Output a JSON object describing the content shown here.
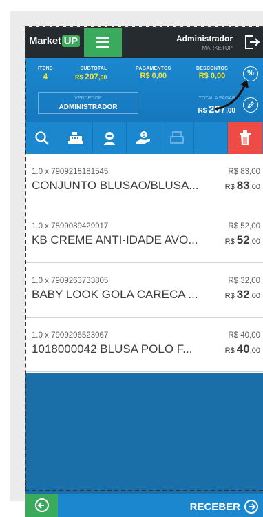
{
  "header": {
    "logo_text": "Market",
    "logo_badge": "UP",
    "user_name": "Administrador",
    "company": "MARKETUP"
  },
  "summary": {
    "items_label": "ITENS",
    "items_value": "4",
    "subtotal_label": "SUBTOTAL",
    "subtotal_currency": "R$ ",
    "subtotal_value": "207",
    "subtotal_cents": ",00",
    "payments_label": "PAGAMENTOS",
    "payments_value": "R$ 0,00",
    "discounts_label": "DESCONTOS",
    "discounts_value": "R$ 0,00",
    "seller_label": "VENDEDOR",
    "seller_value": "ADMINISTRADOR",
    "to_pay_label": "TOTAL A PAGAR",
    "to_pay_currency": "R$ ",
    "to_pay_value": "207",
    "to_pay_cents": ",00",
    "percent_symbol": "%"
  },
  "toolbar": {
    "icons": [
      "search-icon",
      "cash-register-icon",
      "customer-icon",
      "payment-hand-icon",
      "printer-icon",
      "trash-icon"
    ]
  },
  "items": [
    {
      "qty_code": "1.0 x 7909218181545",
      "unit_price": "R$ 83,00",
      "name": "CONJUNTO BLUSAO/BLUSA...",
      "total_currency": "R$ ",
      "total_value": "83",
      "total_cents": ",00"
    },
    {
      "qty_code": "1.0 x 7899089429917",
      "unit_price": "R$ 52,00",
      "name": "KB CREME ANTI-IDADE AVO...",
      "total_currency": "R$ ",
      "total_value": "52",
      "total_cents": ",00"
    },
    {
      "qty_code": "1.0 x 7909263733805",
      "unit_price": "R$ 32,00",
      "name": "BABY LOOK GOLA CARECA ...",
      "total_currency": "R$ ",
      "total_value": "32",
      "total_cents": ",00"
    },
    {
      "qty_code": "1.0 x 7909206523067",
      "unit_price": "R$ 40,00",
      "name": "1018000042 BLUSA POLO F...",
      "total_currency": "R$ ",
      "total_value": "40",
      "total_cents": ",00"
    }
  ],
  "footer": {
    "receive_label": "RECEBER"
  },
  "colors": {
    "accent_green": "#3aaa5c",
    "primary_blue": "#1b87cf",
    "highlight_yellow": "#f2e531",
    "delete_red": "#ee4b44"
  }
}
